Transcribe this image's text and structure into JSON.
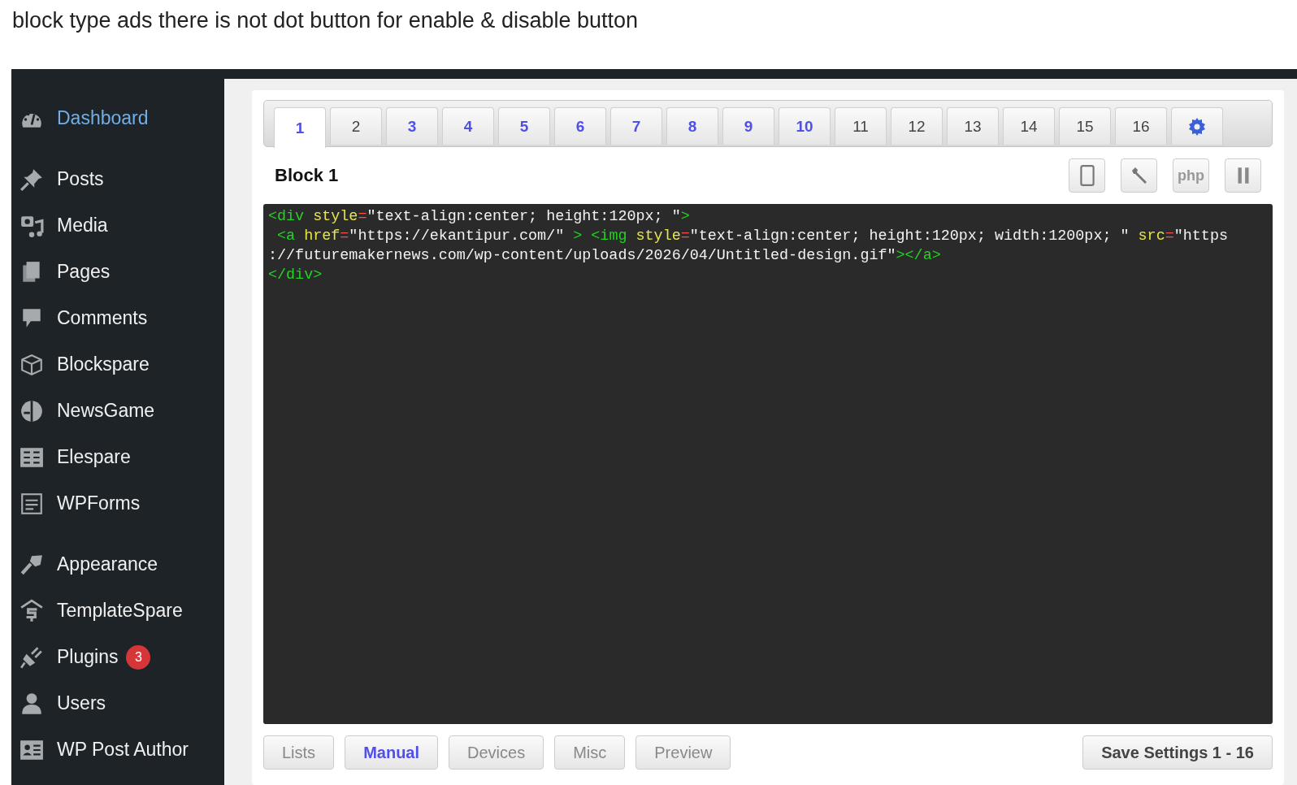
{
  "post_text": "block type ads there is not dot button for enable & disable button",
  "sidebar": {
    "groups": [
      [
        {
          "label": "Dashboard",
          "kind": "gauge",
          "selected": true
        }
      ],
      [
        {
          "label": "Posts",
          "kind": "pin",
          "selected": false
        },
        {
          "label": "Media",
          "kind": "media",
          "selected": false
        },
        {
          "label": "Pages",
          "kind": "pages",
          "selected": false
        },
        {
          "label": "Comments",
          "kind": "comment",
          "selected": false
        },
        {
          "label": "Blockspare",
          "kind": "cube",
          "selected": false
        },
        {
          "label": "NewsGame",
          "kind": "game",
          "selected": false
        },
        {
          "label": "Elespare",
          "kind": "es",
          "selected": false
        },
        {
          "label": "WPForms",
          "kind": "form",
          "selected": false
        }
      ],
      [
        {
          "label": "Appearance",
          "kind": "brush",
          "selected": false
        },
        {
          "label": "TemplateSpare",
          "kind": "ts",
          "selected": false
        },
        {
          "label": "Plugins",
          "kind": "plug",
          "selected": false,
          "badge": "3"
        },
        {
          "label": "Users",
          "kind": "user",
          "selected": false
        },
        {
          "label": "WP Post Author",
          "kind": "card",
          "selected": false
        }
      ]
    ]
  },
  "block_tabs": [
    {
      "label": "1",
      "selected": true,
      "active": true
    },
    {
      "label": "2",
      "selected": false,
      "active": false
    },
    {
      "label": "3",
      "selected": false,
      "active": true
    },
    {
      "label": "4",
      "selected": false,
      "active": true
    },
    {
      "label": "5",
      "selected": false,
      "active": true
    },
    {
      "label": "6",
      "selected": false,
      "active": true
    },
    {
      "label": "7",
      "selected": false,
      "active": true
    },
    {
      "label": "8",
      "selected": false,
      "active": true
    },
    {
      "label": "9",
      "selected": false,
      "active": true
    },
    {
      "label": "10",
      "selected": false,
      "active": true
    },
    {
      "label": "11",
      "selected": false,
      "active": false
    },
    {
      "label": "12",
      "selected": false,
      "active": false
    },
    {
      "label": "13",
      "selected": false,
      "active": false
    },
    {
      "label": "14",
      "selected": false,
      "active": false
    },
    {
      "label": "15",
      "selected": false,
      "active": false
    },
    {
      "label": "16",
      "selected": false,
      "active": false
    }
  ],
  "block_title": "Block 1",
  "toolbar": [
    {
      "kind": "device"
    },
    {
      "kind": "wrench"
    },
    {
      "kind": "text",
      "label": "php"
    },
    {
      "kind": "pause"
    }
  ],
  "code_lines": [
    [
      {
        "kind": "tag",
        "text": "<div"
      },
      {
        "kind": "attr",
        "text": " style"
      },
      {
        "kind": "op",
        "text": "="
      },
      {
        "kind": "string",
        "text": "\"text-align:center; height:120px; \""
      },
      {
        "kind": "tag",
        "text": ">"
      }
    ],
    [
      {
        "kind": "tag",
        "text": " <a"
      },
      {
        "kind": "attr",
        "text": " href"
      },
      {
        "kind": "op",
        "text": "="
      },
      {
        "kind": "string",
        "text": "\"https://ekantipur.com/\""
      },
      {
        "kind": "tag",
        "text": " > <img"
      },
      {
        "kind": "attr",
        "text": " style"
      },
      {
        "kind": "op",
        "text": "="
      },
      {
        "kind": "string",
        "text": "\"text-align:center; height:120px; width:1200px; \""
      },
      {
        "kind": "attr",
        "text": " src"
      },
      {
        "kind": "op",
        "text": "="
      },
      {
        "kind": "string",
        "text": "\"https"
      }
    ],
    [
      {
        "kind": "string",
        "text": "://futuremakernews.com/wp-content/uploads/2026/04/Untitled-design.gif\""
      },
      {
        "kind": "tag",
        "text": "></a>"
      }
    ],
    [
      {
        "kind": "tag",
        "text": "</div>"
      }
    ]
  ],
  "bottom_tabs": [
    {
      "label": "Lists",
      "selected": false
    },
    {
      "label": "Manual",
      "selected": true
    },
    {
      "label": "Devices",
      "selected": false
    },
    {
      "label": "Misc",
      "selected": false
    },
    {
      "label": "Preview",
      "selected": false
    }
  ],
  "save_button": "Save Settings 1 - 16"
}
